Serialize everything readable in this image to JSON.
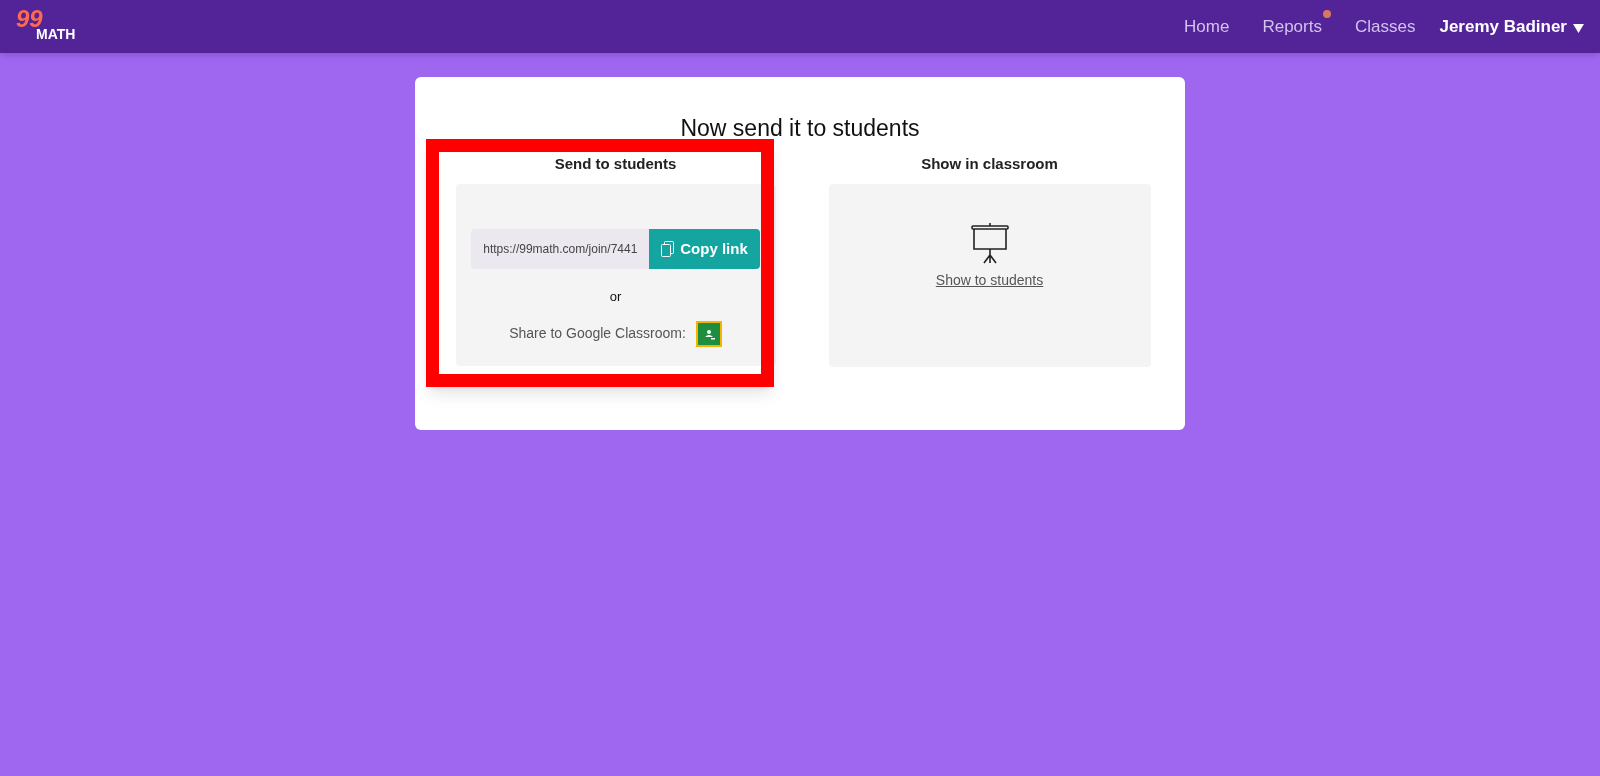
{
  "logo": {
    "digits": "99",
    "word": "MATH"
  },
  "nav": [
    {
      "label": "Home",
      "notification": false
    },
    {
      "label": "Reports",
      "notification": true
    },
    {
      "label": "Classes",
      "notification": false
    }
  ],
  "user_menu": {
    "label": "Jeremy Badiner"
  },
  "card": {
    "title": "Now send it to students",
    "send": {
      "heading": "Send to students",
      "highlighted": true,
      "link": "https://99math.com/join/7441",
      "copy_button": "Copy link",
      "separator": "or",
      "share_label": "Share to Google Classroom:"
    },
    "show": {
      "heading": "Show in classroom",
      "link": "Show to students"
    }
  }
}
